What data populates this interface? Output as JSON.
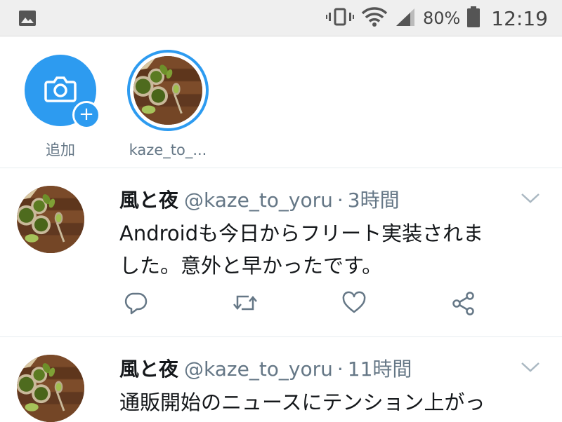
{
  "status_bar": {
    "battery_percent": "80%",
    "time": "12:19",
    "icons": [
      "image-icon",
      "vibrate-icon",
      "wifi-icon",
      "signal-icon",
      "battery-icon"
    ]
  },
  "fleets": [
    {
      "label": "追加",
      "icon": "camera-icon",
      "badge": "+"
    },
    {
      "label": "kaze_to_..."
    }
  ],
  "tweets": [
    {
      "name": "風と夜",
      "handle": "@kaze_to_yoru",
      "separator": "·",
      "time": "3時間",
      "text_line1": "Androidも今日からフリート実装されま",
      "text_line2": "した。意外と早かったです。",
      "actions": [
        "reply-icon",
        "retweet-icon",
        "like-icon",
        "share-icon"
      ]
    },
    {
      "name": "風と夜",
      "handle": "@kaze_to_yoru",
      "separator": "·",
      "time": "11時間",
      "text_line1": "通販開始のニュースにテンション上がっ"
    }
  ],
  "colors": {
    "accent": "#2d9bf0",
    "secondary_text": "#657786",
    "status_bar_bg": "#efefef",
    "divider": "#e6ecf0"
  }
}
